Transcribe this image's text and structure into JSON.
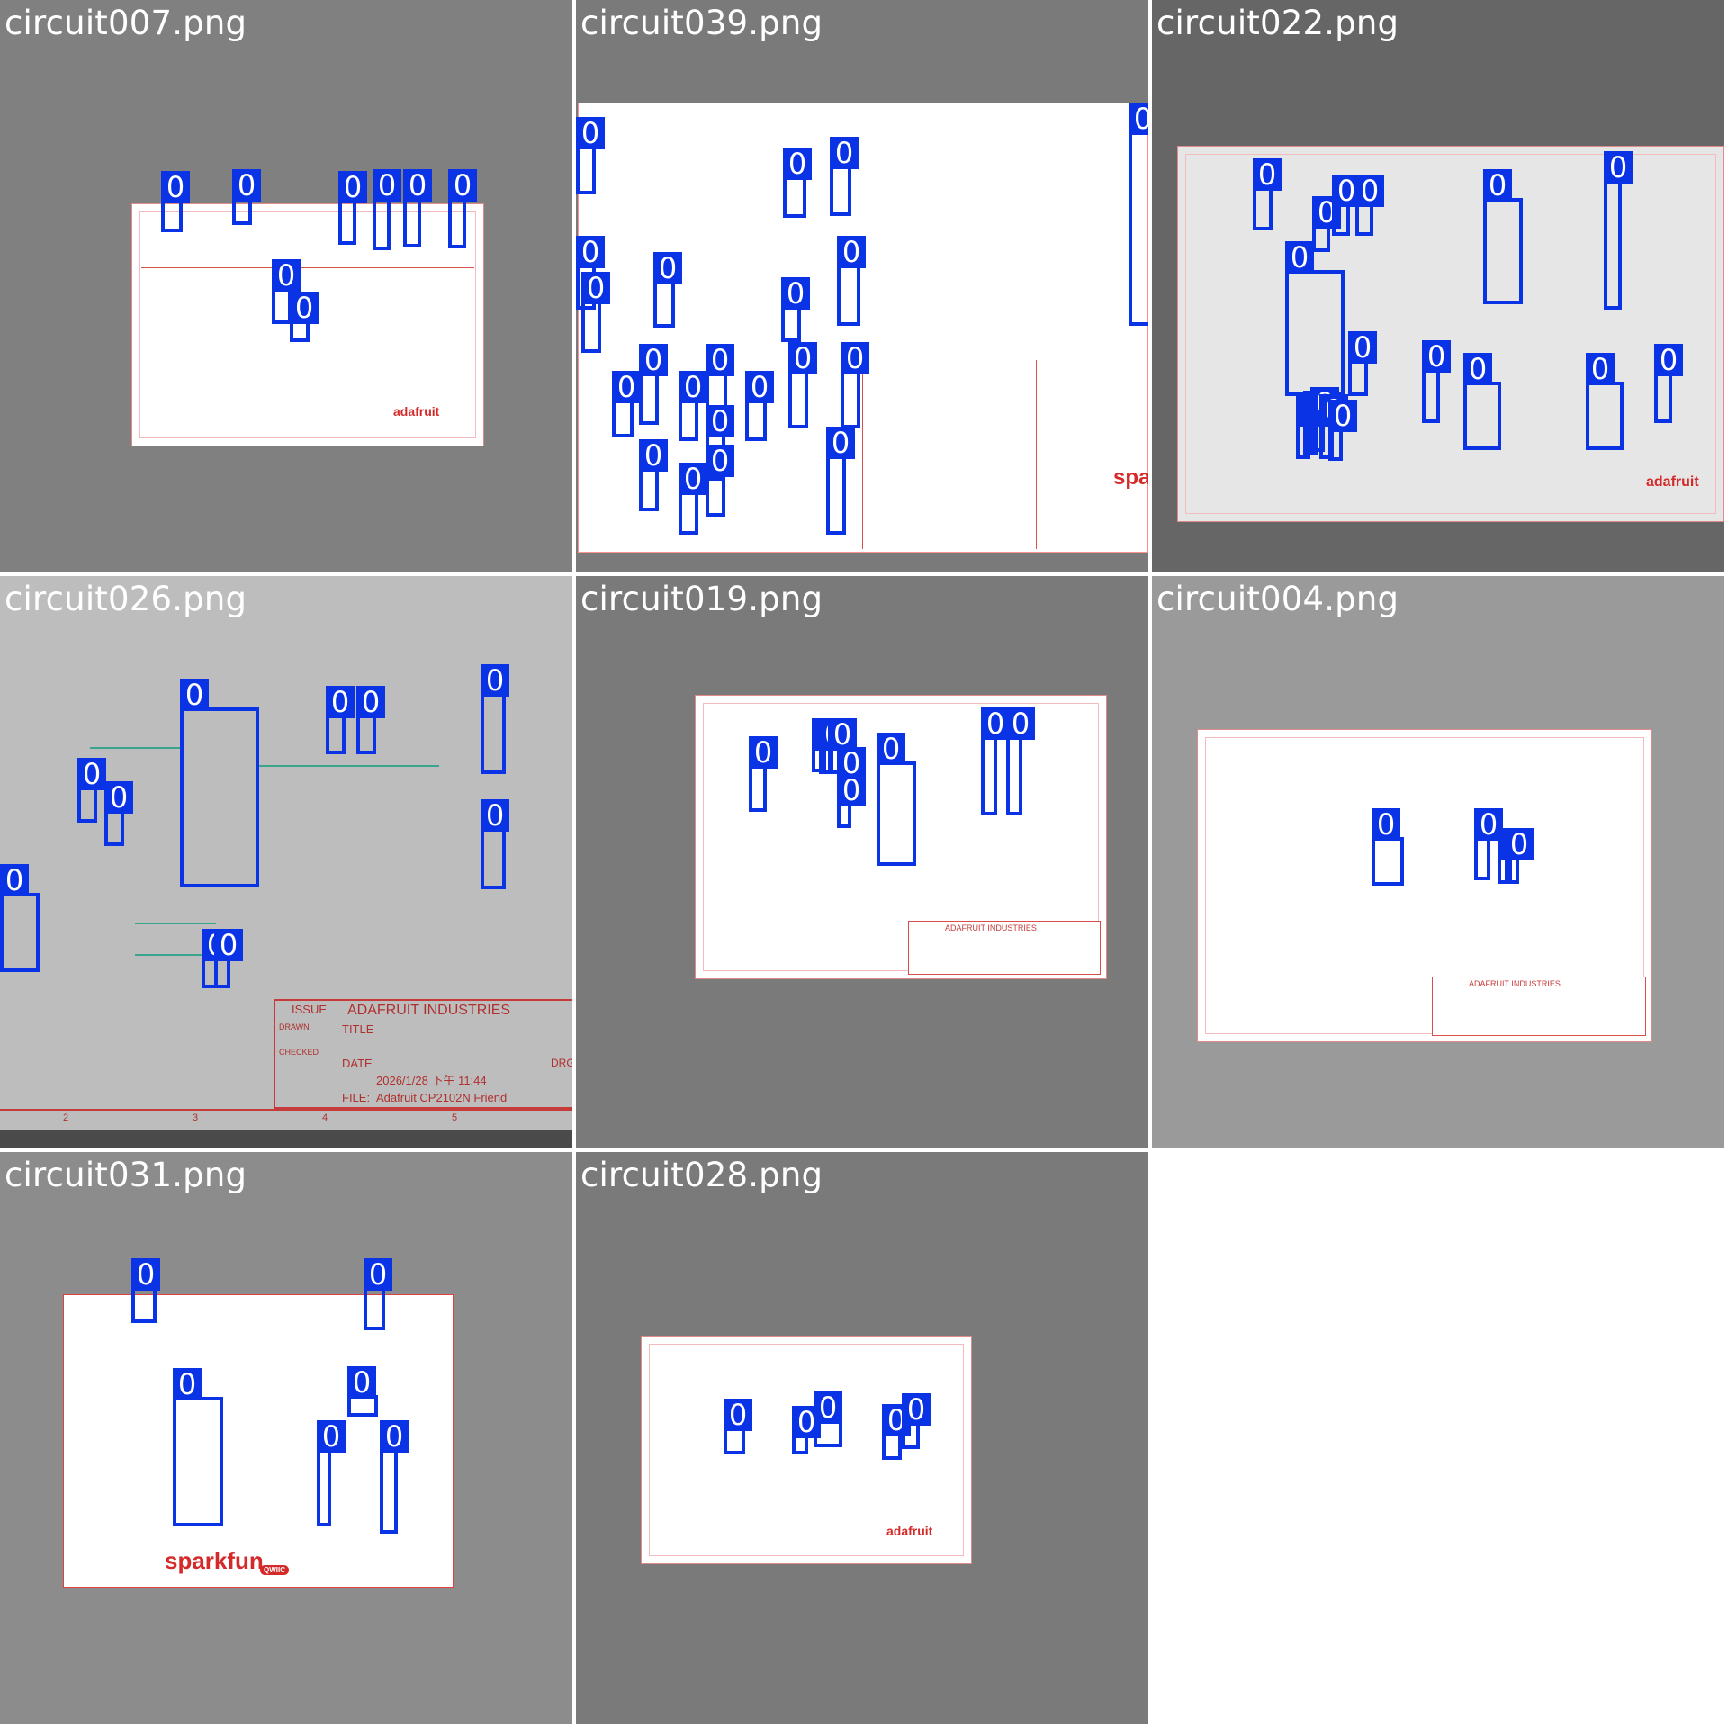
{
  "tiles": [
    {
      "filename": "circuit007.png",
      "bg": "#808080",
      "detections": 8
    },
    {
      "filename": "circuit039.png",
      "bg": "#7a7a7a",
      "detections": 26
    },
    {
      "filename": "circuit022.png",
      "bg": "#666666",
      "detections": 20
    },
    {
      "filename": "circuit026.png",
      "bg": "#bdbdbd",
      "detections": 10
    },
    {
      "filename": "circuit019.png",
      "bg": "#7a7a7a",
      "detections": 9
    },
    {
      "filename": "circuit004.png",
      "bg": "#9a9a9a",
      "detections": 4
    },
    {
      "filename": "circuit031.png",
      "bg": "#8c8c8c",
      "detections": 6
    },
    {
      "filename": "circuit028.png",
      "bg": "#7a7a7a",
      "detections": 6
    }
  ],
  "detection_label": "0",
  "detection_color": "#0a33e6",
  "logos": {
    "adafruit": "adafruit",
    "sparkfun": "sparkfun",
    "spark_partial": "spar",
    "qwiic": "QWIIC"
  },
  "title_block_026": {
    "issue": "ISSUE",
    "company": "ADAFRUIT INDUSTRIES",
    "title_label": "TITLE",
    "date_label": "DATE",
    "date_value": "2026/1/28 下午 11:44",
    "file_label": "FILE:",
    "file_value": "Adafruit CP2102N Friend",
    "drawn": "DRAWN",
    "checked": "CHECKED",
    "dwg": "DRG",
    "cols": [
      "2",
      "3",
      "4",
      "5"
    ]
  },
  "title_block_019": {
    "company": "ADAFRUIT INDUSTRIES"
  },
  "title_block_004": {
    "company": "ADAFRUIT INDUSTRIES"
  }
}
